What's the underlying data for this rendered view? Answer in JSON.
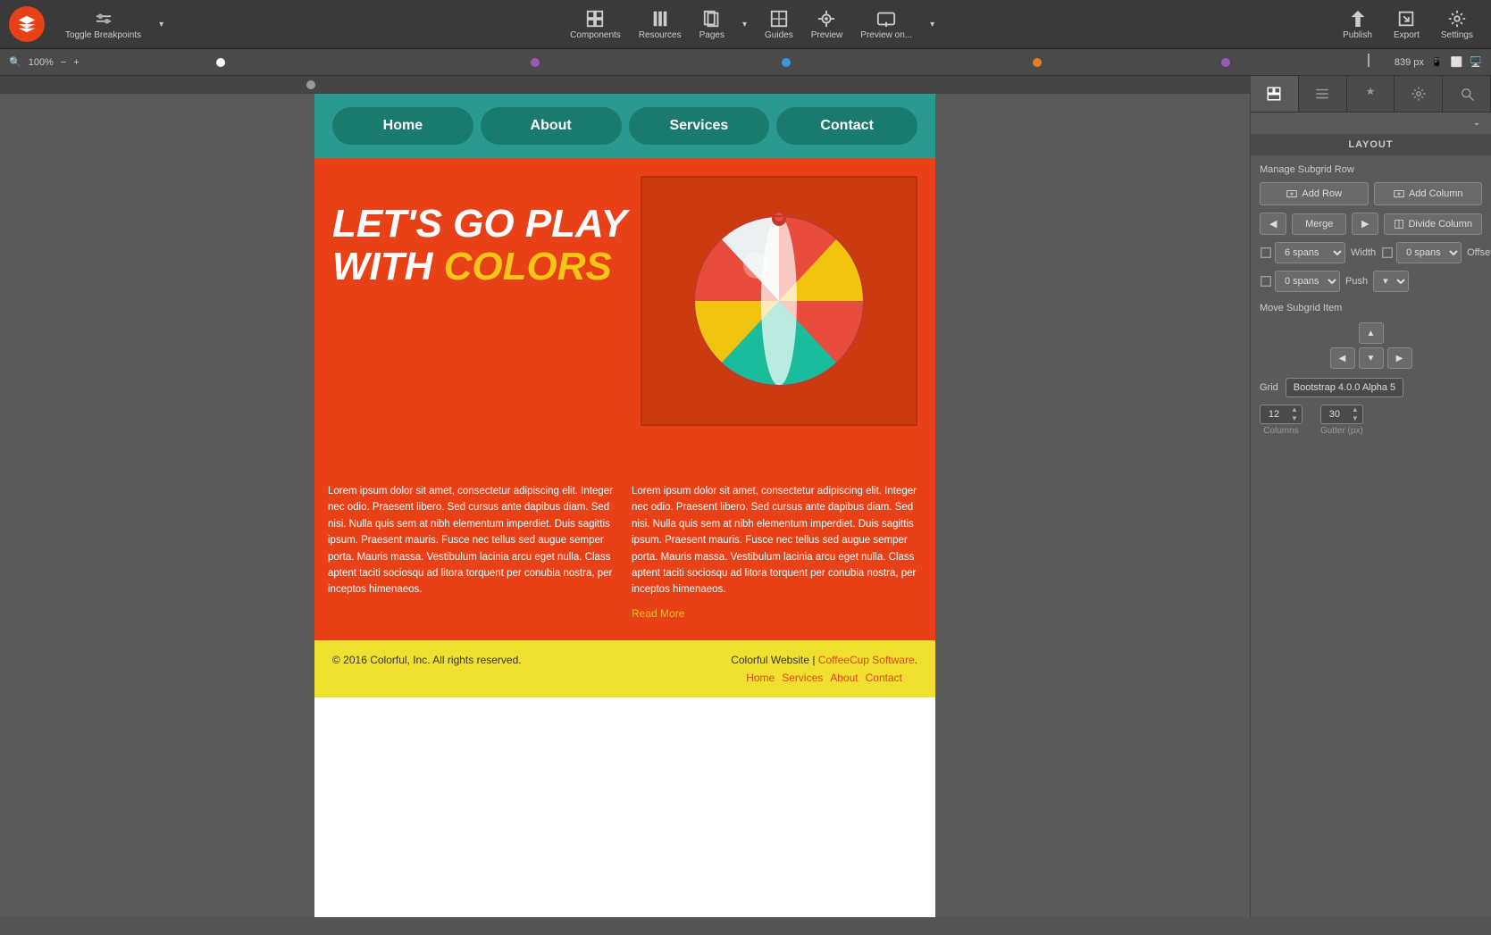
{
  "toolbar": {
    "toggle_breakpoints": "Toggle Breakpoints",
    "components": "Components",
    "resources": "Resources",
    "pages": "Pages",
    "guides": "Guides",
    "preview": "Preview",
    "preview_on": "Preview on...",
    "publish": "Publish",
    "export": "Export",
    "settings": "Settings"
  },
  "zoom": {
    "level": "100%",
    "px": "839 px"
  },
  "ruler": {
    "dots": [
      "white",
      "#9b59b6",
      "#3498db",
      "#e67e22",
      "#9b59b6"
    ]
  },
  "nav": {
    "home": "Home",
    "about": "About",
    "services": "Services",
    "contact": "Contact"
  },
  "hero": {
    "title_line1": "LET'S GO PLAY",
    "title_line2": "WITH",
    "title_colors": "COLORS"
  },
  "lorem": {
    "text": "Lorem ipsum dolor sit amet, consectetur adipiscing elit. Integer nec odio. Praesent libero. Sed cursus ante dapibus diam. Sed nisi. Nulla quis sem at nibh elementum imperdiet. Duis sagittis ipsum. Praesent mauris. Fusce nec tellus sed augue semper porta. Mauris massa. Vestibulum lacinia arcu eget nulla. Class aptent taciti sociosqu ad litora torquent per conubia nostra, per inceptos himenaeos."
  },
  "read_more": "Read More",
  "footer": {
    "copy": "© 2016 Colorful, Inc. All rights reserved.",
    "site_name": "Colorful Website",
    "separator": " | ",
    "coffeecup": "CoffeeCup Software",
    "period": ".",
    "nav_home": "Home",
    "nav_services": "Services",
    "nav_about": "About",
    "nav_contact": "Contact"
  },
  "panel": {
    "section_title": "LAYOUT",
    "add_row": "Add Row",
    "add_column": "Add Column",
    "merge": "Merge",
    "divide_column": "Divide Column",
    "spans_label1": "6 spans",
    "width_label": "Width",
    "spans_label2": "0 spans",
    "offset_label": "Offset",
    "spans_label3": "0 spans",
    "push_label": "Push",
    "move_subgrid_title": "Move Subgrid Item",
    "grid_label": "Grid",
    "grid_value": "Bootstrap 4.0.0 Alpha 5",
    "columns_val": "12",
    "gutter_val": "30",
    "columns_label": "Columns",
    "gutter_label": "Gutter (px)"
  }
}
